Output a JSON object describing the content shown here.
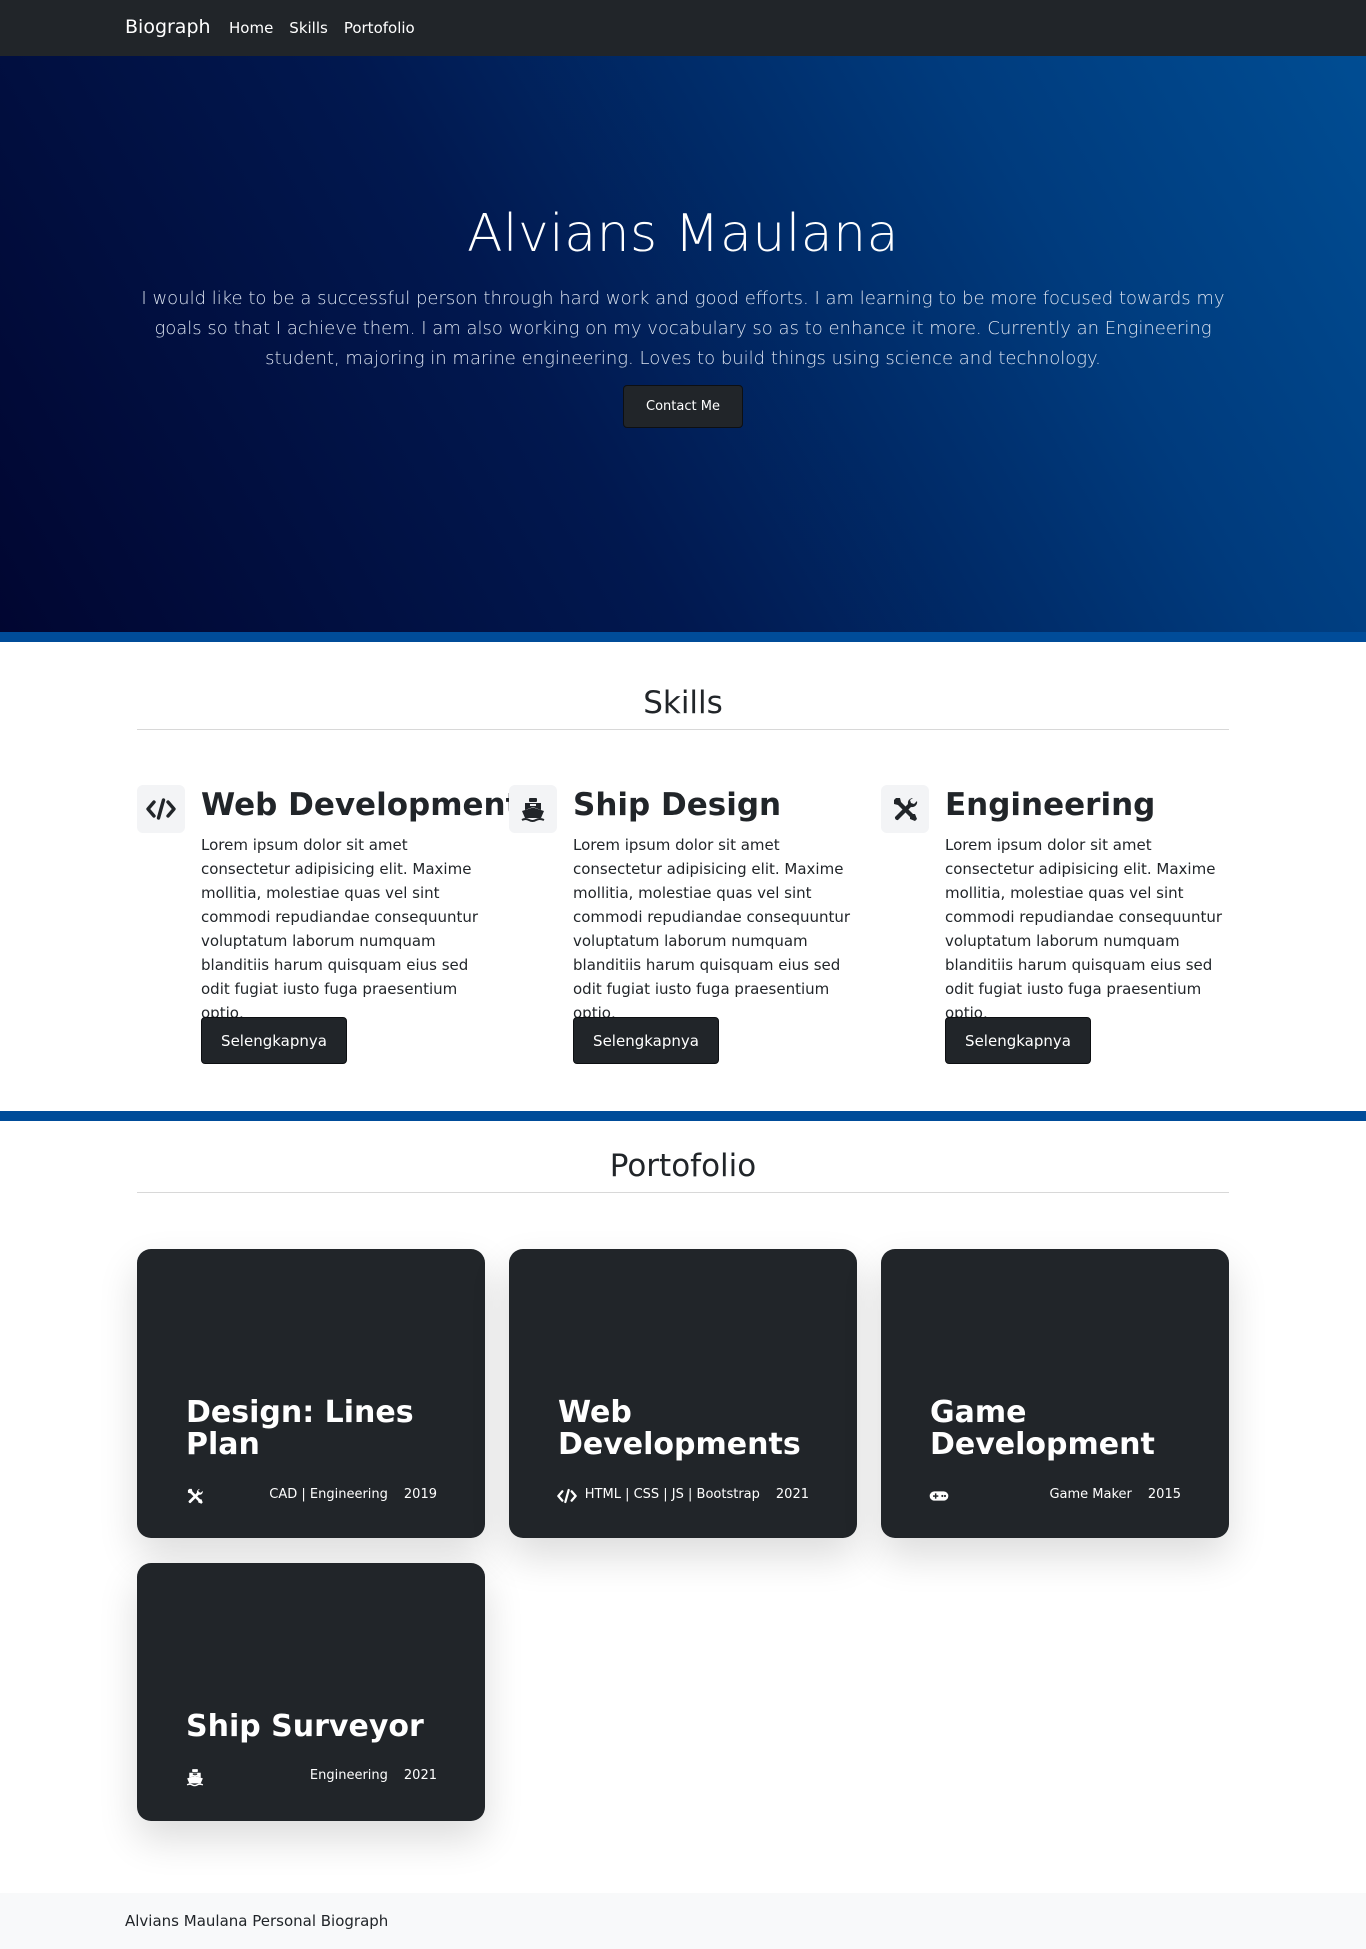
{
  "nav": {
    "brand": "Biograph",
    "links": [
      "Home",
      "Skills",
      "Portofolio"
    ]
  },
  "hero": {
    "name": "Alvians Maulana",
    "bio": "I would like to be a successful person through hard work and good efforts. I am learning to be more focused towards my goals so that I achieve them. I am also working on my vocabulary so as to enhance it more. Currently an Engineering student, majoring in marine engineering. Loves to build things using science and technology.",
    "contact_label": "Contact Me"
  },
  "skills": {
    "heading": "Skills",
    "items": [
      {
        "icon": "code-icon",
        "title": "Web Development",
        "text": "Lorem ipsum dolor sit amet consectetur adipisicing elit. Maxime mollitia, molestiae quas vel sint commodi repudiandae consequuntur voluptatum laborum numquam blanditiis harum quisquam eius sed odit fugiat iusto fuga praesentium optio,",
        "button": "Selengkapnya"
      },
      {
        "icon": "ship-icon",
        "title": "Ship Design",
        "text": "Lorem ipsum dolor sit amet consectetur adipisicing elit. Maxime mollitia, molestiae quas vel sint commodi repudiandae consequuntur voluptatum laborum numquam blanditiis harum quisquam eius sed odit fugiat iusto fuga praesentium optio,",
        "button": "Selengkapnya"
      },
      {
        "icon": "tools-icon",
        "title": "Engineering",
        "text": "Lorem ipsum dolor sit amet consectetur adipisicing elit. Maxime mollitia, molestiae quas vel sint commodi repudiandae consequuntur voluptatum laborum numquam blanditiis harum quisquam eius sed odit fugiat iusto fuga praesentium optio,",
        "button": "Selengkapnya"
      }
    ]
  },
  "portfolio": {
    "heading": "Portofolio",
    "cards": [
      {
        "icon": "tools-icon",
        "title": "Design: Lines Plan",
        "tags": "CAD | Engineering",
        "year": "2019"
      },
      {
        "icon": "code-icon",
        "title": "Web Developments",
        "tags": "HTML | CSS | JS | Bootstrap",
        "year": "2021"
      },
      {
        "icon": "gamepad-icon",
        "title": "Game Development",
        "tags": "Game Maker",
        "year": "2015"
      },
      {
        "icon": "ship-icon",
        "title": "Ship Surveyor",
        "tags": "Engineering",
        "year": "2021"
      }
    ]
  },
  "footer": {
    "text": "Alvians Maulana Personal Biograph"
  },
  "colors": {
    "navbar": "#212529",
    "accent_stripe": "#004c99",
    "hero_dark": "#010631",
    "hero_light": "#004d93",
    "card": "#212529",
    "footer": "#f8f9fa"
  }
}
